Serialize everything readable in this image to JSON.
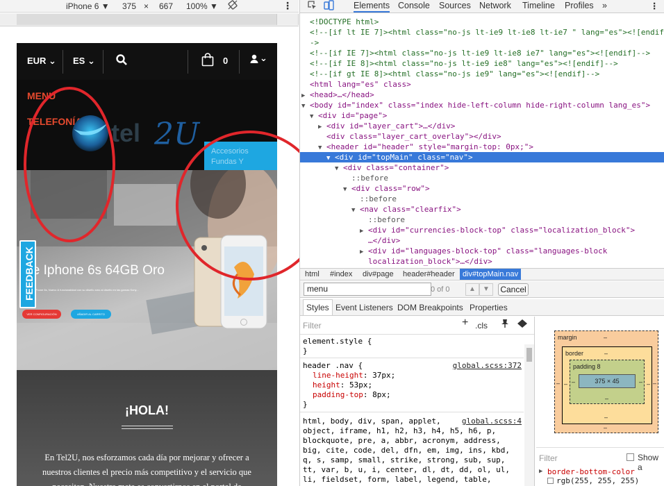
{
  "device_toolbar": {
    "device": "iPhone 6 ▼",
    "width": "375",
    "times": "×",
    "height": "667",
    "zoom": "100% ▼",
    "rotate_icon": "rotate-icon",
    "more": "⋮"
  },
  "phone": {
    "nav": {
      "currency": "EUR ⌄",
      "language": "ES ⌄",
      "cart_count": "0",
      "user": "⌄"
    },
    "menu_label": "MENU",
    "telefonia_label": "TELEFONÍA",
    "logo_text": "tel2U",
    "dropdown_items": [
      "Accesorios",
      "Fundas Y"
    ],
    "hero": {
      "title": "ple Iphone 6s 64GB Oro",
      "small_text": "s 64GB\n9 iPhone 6s, Nuevo & funcionalidad con su diseño\nsmo al diseño en las gamas Sony...",
      "btn1": "VER CONFIGURACIÓN",
      "btn2": "AÑADIR AL CARRITO"
    },
    "feedback_label": "FEEDBACK",
    "hola": {
      "title": "¡HOLA!",
      "text": "En Tel2U, nos esforzamos cada día por mejorar y ofrecer a nuestros clientes el precio más competitivo y el servicio que necesitan. Nuestra meta es convertirnos en el portal de"
    }
  },
  "devtools": {
    "tabs": [
      "Elements",
      "Console",
      "Sources",
      "Network",
      "Timeline",
      "Profiles",
      "»"
    ],
    "active_tab": "Elements",
    "dom_lines": [
      {
        "indent": 0,
        "arrow": "",
        "html": "<!DOCTYPE html>",
        "kind": "comment"
      },
      {
        "indent": 0,
        "arrow": "",
        "html": "<!--[if lt IE 7]><html class=\"no-js lt-ie9 lt-ie8 lt-ie7 \" lang=\"es\"><![endif]",
        "kind": "comment"
      },
      {
        "indent": 0,
        "arrow": "",
        "html": "->",
        "kind": "comment"
      },
      {
        "indent": 0,
        "arrow": "",
        "html": "<!--[if IE 7]><html class=\"no-js lt-ie9 lt-ie8 ie7\" lang=\"es\"><![endif]-->",
        "kind": "comment"
      },
      {
        "indent": 0,
        "arrow": "",
        "html": "<!--[if IE 8]><html class=\"no-js lt-ie9 ie8\" lang=\"es\"><![endif]-->",
        "kind": "comment"
      },
      {
        "indent": 0,
        "arrow": "",
        "html": "<!--[if gt IE 8]><html class=\"no-js ie9\" lang=\"es\"><![endif]-->",
        "kind": "comment"
      },
      {
        "indent": 0,
        "arrow": "",
        "html": "<html lang=\"es\" class>",
        "kind": "tag"
      },
      {
        "indent": 0,
        "arrow": "▶",
        "html": "<head>…</head>",
        "kind": "tag"
      },
      {
        "indent": 0,
        "arrow": "▼",
        "html": "<body id=\"index\" class=\"index hide-left-column hide-right-column lang_es\">",
        "kind": "tag"
      },
      {
        "indent": 1,
        "arrow": "▼",
        "html": "<div id=\"page\">",
        "kind": "tag"
      },
      {
        "indent": 2,
        "arrow": "▶",
        "html": "<div id=\"layer_cart\">…</div>",
        "kind": "tag"
      },
      {
        "indent": 2,
        "arrow": "",
        "html": "<div class=\"layer_cart_overlay\"></div>",
        "kind": "tag"
      },
      {
        "indent": 2,
        "arrow": "▼",
        "html": "<header id=\"header\" style=\"margin-top: 0px;\">",
        "kind": "tag"
      },
      {
        "indent": 3,
        "arrow": "▼",
        "html": "<div id=\"topMain\" class=\"nav\">",
        "kind": "tag",
        "selected": true
      },
      {
        "indent": 4,
        "arrow": "▼",
        "html": "<div class=\"container\">",
        "kind": "tag"
      },
      {
        "indent": 5,
        "arrow": "",
        "html": "::before",
        "kind": "pseudo"
      },
      {
        "indent": 5,
        "arrow": "▼",
        "html": "<div class=\"row\">",
        "kind": "tag"
      },
      {
        "indent": 6,
        "arrow": "",
        "html": "::before",
        "kind": "pseudo"
      },
      {
        "indent": 6,
        "arrow": "▼",
        "html": "<nav class=\"clearfix\">",
        "kind": "tag"
      },
      {
        "indent": 7,
        "arrow": "",
        "html": "::before",
        "kind": "pseudo"
      },
      {
        "indent": 7,
        "arrow": "▶",
        "html": "<div id=\"currencies-block-top\" class=\"localization_block\">",
        "kind": "tag"
      },
      {
        "indent": 7,
        "arrow": "",
        "html": "…</div>",
        "kind": "tag"
      },
      {
        "indent": 7,
        "arrow": "▶",
        "html": "<div id=\"languages-block-top\" class=\"languages-block",
        "kind": "tag"
      },
      {
        "indent": 7,
        "arrow": "",
        "html": "localization_block\">…</div>",
        "kind": "tag"
      }
    ],
    "breadcrumbs": [
      "html",
      "#index",
      "div#page",
      "header#header",
      "div#topMain.nav"
    ],
    "find": {
      "value": "menu",
      "count": "0 of 0",
      "cancel": "Cancel"
    },
    "subtabs": [
      "Styles",
      "Event Listeners",
      "DOM Breakpoints",
      "Properties"
    ],
    "styles": {
      "filter_placeholder": "Filter",
      "cls": ".cls",
      "element_style": "element.style {",
      "close_brace": "}",
      "header_rule": "header .nav {",
      "header_src": "global.scss:372",
      "props": [
        {
          "name": "line-height",
          "value": "37px;"
        },
        {
          "name": "height",
          "value": "53px;"
        },
        {
          "name": "padding-top",
          "value": "8px;"
        }
      ],
      "reset_src": "global.scss:4",
      "reset_lines": [
        "html, body, div, span, applet,",
        "object, iframe, h1, h2, h3, h4, h5, h6, p,",
        "blockquote, pre, a, abbr, acronym, address,",
        "big, cite, code, del, dfn, em, img, ins, kbd,",
        "q, s, samp, small, strike, strong, sub, sup,",
        "tt, var, b, u, i, center, dl, dt, dd, ol, ul,",
        "li, fieldset, form, label, legend, table,"
      ]
    },
    "boxmodel": {
      "margin": "margin",
      "border": "border",
      "padding": "padding 8",
      "content": "375 × 45",
      "dash": "–"
    },
    "computed": {
      "filter": "Filter",
      "show_all": "Show a",
      "prop": "border-bottom-color",
      "value": "rgb(255, 255, 255)"
    }
  },
  "colors": {
    "accent": "#3879d9",
    "brand_blue": "#1ea7e1",
    "menu_red": "#e64a2e",
    "annotation_red": "#e0262b"
  }
}
